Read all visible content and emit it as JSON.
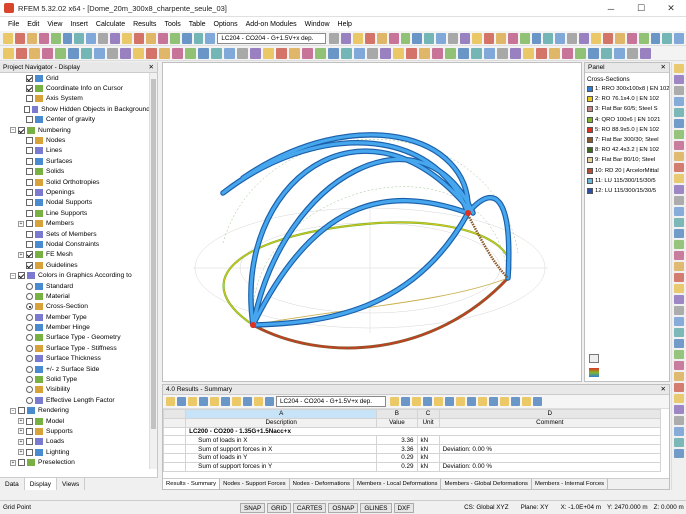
{
  "window": {
    "title": "RFEM 5.32.02 x64 - [Dome_20m_300x8_charpente_seule_03]"
  },
  "menu": [
    "File",
    "Edit",
    "View",
    "Insert",
    "Calculate",
    "Results",
    "Tools",
    "Table",
    "Options",
    "Add-on Modules",
    "Window",
    "Help"
  ],
  "toolbar": {
    "loadcase": "LC204 - CO204 - G+1.5V+x dep."
  },
  "navigator": {
    "title": "Project Navigator - Display",
    "items": [
      {
        "label": "Grid",
        "indent": 1,
        "ctl": "cb",
        "on": true
      },
      {
        "label": "Coordinate Info on Cursor",
        "indent": 1,
        "ctl": "cb",
        "on": true
      },
      {
        "label": "Axis System",
        "indent": 1,
        "ctl": "cb",
        "on": false
      },
      {
        "label": "Show Hidden Objects in Background",
        "indent": 1,
        "ctl": "cb",
        "on": false
      },
      {
        "label": "Center of gravity",
        "indent": 1,
        "ctl": "cb",
        "on": false
      },
      {
        "label": "Numbering",
        "indent": 0,
        "ctl": "cb",
        "on": true,
        "exp": "−"
      },
      {
        "label": "Nodes",
        "indent": 1,
        "ctl": "cb",
        "on": false
      },
      {
        "label": "Lines",
        "indent": 1,
        "ctl": "cb",
        "on": false
      },
      {
        "label": "Surfaces",
        "indent": 1,
        "ctl": "cb",
        "on": false
      },
      {
        "label": "Solids",
        "indent": 1,
        "ctl": "cb",
        "on": false
      },
      {
        "label": "Solid Orthotropies",
        "indent": 1,
        "ctl": "cb",
        "on": false
      },
      {
        "label": "Openings",
        "indent": 1,
        "ctl": "cb",
        "on": false
      },
      {
        "label": "Nodal Supports",
        "indent": 1,
        "ctl": "cb",
        "on": false
      },
      {
        "label": "Line Supports",
        "indent": 1,
        "ctl": "cb",
        "on": false
      },
      {
        "label": "Members",
        "indent": 1,
        "ctl": "cb",
        "on": false,
        "exp": "+"
      },
      {
        "label": "Sets of Members",
        "indent": 1,
        "ctl": "cb",
        "on": false
      },
      {
        "label": "Nodal Constraints",
        "indent": 1,
        "ctl": "cb",
        "on": false
      },
      {
        "label": "FE Mesh",
        "indent": 1,
        "ctl": "cb",
        "on": true,
        "exp": "+"
      },
      {
        "label": "Guidelines",
        "indent": 1,
        "ctl": "cb",
        "on": true
      },
      {
        "label": "Colors in Graphics According to",
        "indent": 0,
        "ctl": "cb",
        "on": true,
        "exp": "−"
      },
      {
        "label": "Standard",
        "indent": 1,
        "ctl": "rb",
        "on": false
      },
      {
        "label": "Material",
        "indent": 1,
        "ctl": "rb",
        "on": false
      },
      {
        "label": "Cross-Section",
        "indent": 1,
        "ctl": "rb",
        "on": true
      },
      {
        "label": "Member Type",
        "indent": 1,
        "ctl": "rb",
        "on": false
      },
      {
        "label": "Member Hinge",
        "indent": 1,
        "ctl": "rb",
        "on": false
      },
      {
        "label": "Surface Type - Geometry",
        "indent": 1,
        "ctl": "rb",
        "on": false
      },
      {
        "label": "Surface Type - Stiffness",
        "indent": 1,
        "ctl": "rb",
        "on": false
      },
      {
        "label": "Surface Thickness",
        "indent": 1,
        "ctl": "rb",
        "on": false
      },
      {
        "label": "+/- z Surface Side",
        "indent": 1,
        "ctl": "rb",
        "on": false
      },
      {
        "label": "Solid Type",
        "indent": 1,
        "ctl": "rb",
        "on": false
      },
      {
        "label": "Visibility",
        "indent": 1,
        "ctl": "rb",
        "on": false
      },
      {
        "label": "Effective Length Factor",
        "indent": 1,
        "ctl": "rb",
        "on": false
      },
      {
        "label": "Rendering",
        "indent": 0,
        "ctl": "cb",
        "on": false,
        "exp": "−"
      },
      {
        "label": "Model",
        "indent": 1,
        "ctl": "cb",
        "on": false,
        "exp": "+"
      },
      {
        "label": "Supports",
        "indent": 1,
        "ctl": "cb",
        "on": false,
        "exp": "+"
      },
      {
        "label": "Loads",
        "indent": 1,
        "ctl": "cb",
        "on": false,
        "exp": "+"
      },
      {
        "label": "Lighting",
        "indent": 1,
        "ctl": "cb",
        "on": false,
        "exp": "+"
      },
      {
        "label": "Preselection",
        "indent": 0,
        "ctl": "cb",
        "on": false,
        "exp": "+"
      },
      {
        "label": "Add-on Modules",
        "indent": 0,
        "ctl": "cb",
        "on": false,
        "exp": "+"
      }
    ],
    "tabs": [
      "Data",
      "Display",
      "Views"
    ]
  },
  "panel": {
    "title": "Panel",
    "subtitle": "Cross-Sections",
    "items": [
      {
        "label": "1: RRO 300x100x8 | EN 102",
        "color": "#2e7fd6"
      },
      {
        "label": "2: RO 76.1x4.0 | EN 102",
        "color": "#e8c61a"
      },
      {
        "label": "3: Flat Bar 60/5; Steel S",
        "color": "#c98282"
      },
      {
        "label": "4: QRO 100x6 | EN 1021",
        "color": "#7fb82c"
      },
      {
        "label": "5: RO 88.9x5.0 | EN 102",
        "color": "#e0311f"
      },
      {
        "label": "7: Flat Bar 300/30; Steel",
        "color": "#8b5a2b"
      },
      {
        "label": "8: RO 42.4x3.2 | EN 102",
        "color": "#3e6b1e"
      },
      {
        "label": "9: Flat Bar 80/10; Steel",
        "color": "#e8d29a"
      },
      {
        "label": "10: RD 20 | ArcelorMittal",
        "color": "#b2503a"
      },
      {
        "label": "11: LU 115/300/15/30/5",
        "color": "#6ab7d9"
      },
      {
        "label": "12: LU 115/300/15/30/5",
        "color": "#2d4fa8"
      }
    ]
  },
  "results": {
    "title": "4.0 Results - Summary",
    "loadcase": "LC204 - CO204 - G+1.5V+x dep.",
    "col_letters": [
      "A",
      "B",
      "C",
      "D"
    ],
    "col_heads": [
      "Description",
      "Value",
      "Unit",
      "Comment"
    ],
    "group": "LC200 - CO200 - 1.35G+1.5Nacc+x",
    "rows": [
      {
        "d": "Sum of loads in X",
        "v": "3.36",
        "u": "kN",
        "c": ""
      },
      {
        "d": "Sum of support forces in X",
        "v": "3.36",
        "u": "kN",
        "c": "Deviation:  0.00 %"
      },
      {
        "d": "Sum of loads in Y",
        "v": "0.29",
        "u": "kN",
        "c": ""
      },
      {
        "d": "Sum of support forces in Y",
        "v": "0.29",
        "u": "kN",
        "c": "Deviation:  0.00 %"
      }
    ],
    "tabs": [
      "Results - Summary",
      "Nodes - Support Forces",
      "Nodes - Deformations",
      "Members - Local Deformations",
      "Members - Global Deformations",
      "Members - Internal Forces"
    ]
  },
  "status": {
    "left": "Grid Point",
    "toggles": [
      "SNAP",
      "GRID",
      "CARTES",
      "OSNAP",
      "GLINES",
      "DXF"
    ],
    "coord_sys": "CS: Global XYZ",
    "plane": "Plane: XY",
    "x": "X: -1.0E+04 m",
    "y": "Y: 2470.000 m",
    "z": "Z: 0.000 m"
  }
}
